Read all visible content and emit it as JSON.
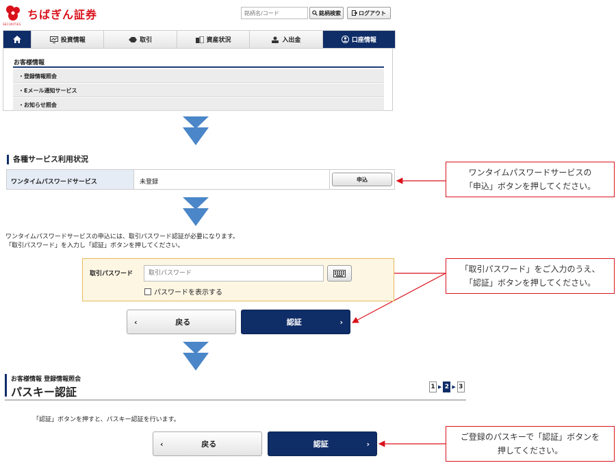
{
  "header": {
    "logo_text": "ちばぎん証券",
    "logo_sub": "SECURITIES",
    "search_placeholder": "銘柄名/コード",
    "search_button": "銘柄検索",
    "logout_button": "ログアウト"
  },
  "nav": {
    "home_icon": "home-icon",
    "items": [
      "投資情報",
      "取引",
      "資産状況",
      "入出金",
      "口座情報"
    ],
    "active": "口座情報"
  },
  "dropdown": {
    "title": "お客様情報",
    "items": [
      "登録情報照会",
      "Eメール通知サービス",
      "お知らせ照会"
    ]
  },
  "service": {
    "section_title": "各種サービス利用状況",
    "name": "ワンタイムパスワードサービス",
    "status": "未登録",
    "apply_button": "申込"
  },
  "callouts": {
    "c1": [
      "ワンタイムパスワードサービスの",
      "「申込」ボタンを押してください。"
    ],
    "c2": [
      "「取引パスワード」をご入力のうえ、",
      "「認証」ボタンを押してください。"
    ],
    "c3": [
      "ご登録のパスキーで「認証」ボタンを",
      "押してください。"
    ]
  },
  "instructions": [
    "ワンタイムパスワードサービスの申込には、取引パスワード認証が必要になります。",
    "「取引パスワード」を入力し「認証」ボタンを押してください。"
  ],
  "password": {
    "label": "取引パスワード",
    "placeholder": "取引パスワード",
    "show_label": "パスワードを表示する"
  },
  "buttons": {
    "back": "戻る",
    "auth": "認証"
  },
  "passkey": {
    "breadcrumb": "お客様情報 登録情報照会",
    "title": "パスキー認証",
    "steps": [
      "1",
      "2",
      "3"
    ],
    "current_step": "2",
    "text": "「認証」ボタンを押すと、パスキー認証を行います。"
  },
  "colors": {
    "navy": "#0f2d67",
    "red": "#d9111b",
    "arrow": "#4a86c8"
  }
}
